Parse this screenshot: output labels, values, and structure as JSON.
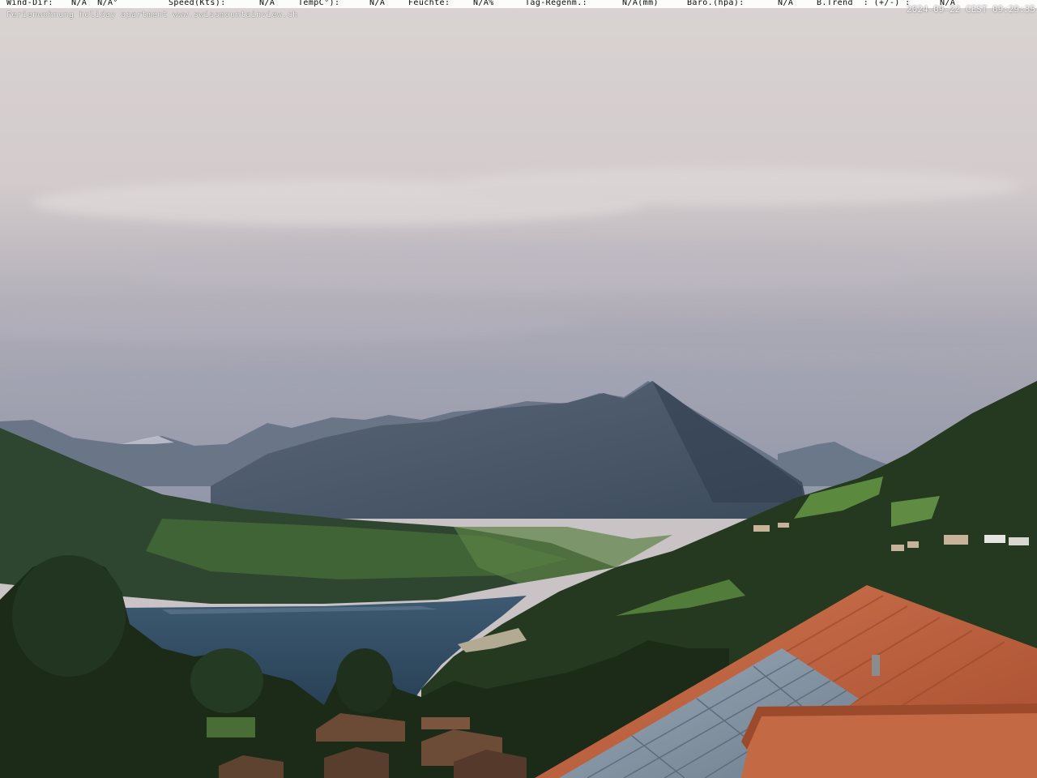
{
  "weather_bar": {
    "wind_dir_label": "Wind-Dir:",
    "wind_dir_value": "N/A  N/A°",
    "speed_label": "Speed(Kts):",
    "speed_value": "N/A",
    "temp_label": "TempC°):",
    "temp_value": "N/A",
    "humidity_label": "Feuchte:",
    "humidity_value": "N/A%",
    "rain_label": "Tag-Regenm.:",
    "rain_value": "N/A(mm)",
    "baro_label": "Baro.(hpa):",
    "baro_value": "N/A",
    "trend_label": "B.Trend  : (+/-) :",
    "trend_value": "N/A"
  },
  "caption": "Ferienwohnung holiday apartment www.swissmountainview.ch",
  "timestamp": "2024-09-22 CEST 09:29:35",
  "colors": {
    "sky_top": "#d8d1d1",
    "sky_mid": "#a9a7b3",
    "mountain": "#47566a",
    "lake": "#2f4c63",
    "forest": "#1f3420",
    "meadow": "#4f7a3a",
    "roof": "#c0623c",
    "solar": "#8497a8"
  }
}
